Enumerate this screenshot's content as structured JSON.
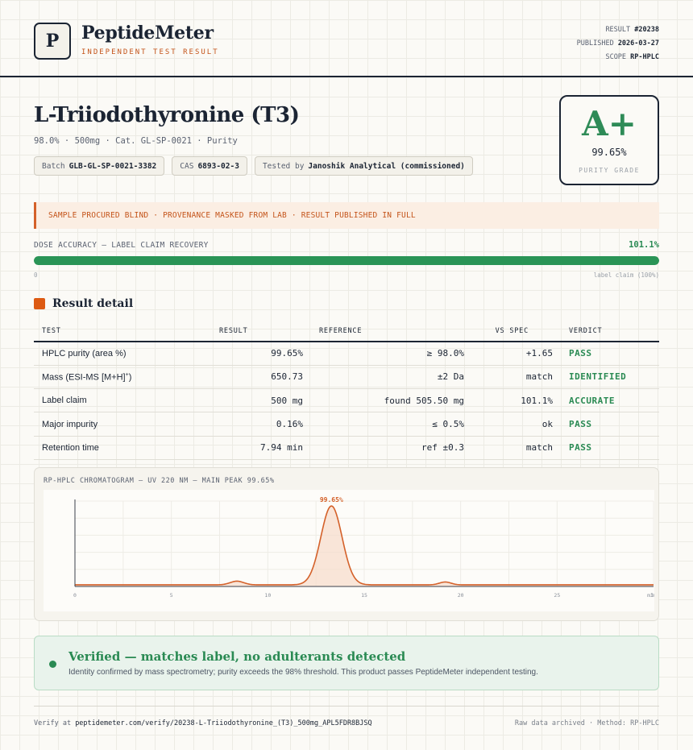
{
  "header": {
    "logo_letter": "P",
    "brand": "PeptideMeter",
    "tagline": "INDEPENDENT TEST RESULT",
    "result_label": "RESULT",
    "result_id": "#20238",
    "published_label": "PUBLISHED",
    "published_date": "2026-03-27",
    "scope_label": "SCOPE",
    "scope_value": "RP-HPLC"
  },
  "product": {
    "title": "L-Triiodothyronine (T3)",
    "subtitle": "98.0% · 500mg · Cat. GL-SP-0021 · Purity",
    "chips": {
      "batch_label": "Batch",
      "batch_value": "GLB-GL-SP-0021-3382",
      "cas_label": "CAS",
      "cas_value": "6893-02-3",
      "tested_label": "Tested by",
      "tested_value": "Janoshik Analytical (commissioned)"
    }
  },
  "grade": {
    "letter": "A+",
    "value": "99.65%",
    "label": "PURITY GRADE"
  },
  "notice": "SAMPLE PROCURED BLIND · PROVENANCE MASKED FROM LAB · RESULT PUBLISHED IN FULL",
  "dose": {
    "label": "DOSE ACCURACY — LABEL CLAIM RECOVERY",
    "value": "101.1%",
    "fill_fraction": 1.0,
    "min_label": "0",
    "max_label": "label claim (100%)"
  },
  "section_title": "Result detail",
  "table": {
    "headers": [
      "TEST",
      "RESULT",
      "REFERENCE",
      "VS SPEC",
      "VERDICT"
    ],
    "rows": [
      {
        "test": "HPLC purity (area %)",
        "test_sup": "",
        "result": "99.65%",
        "reference": "≥ 98.0%",
        "vs_spec": "+1.65",
        "verdict": "PASS"
      },
      {
        "test": "Mass (ESI-MS [M+H]",
        "test_sup": "+",
        "test_tail": ")",
        "result": "650.73",
        "reference": "±2 Da",
        "vs_spec": "match",
        "verdict": "IDENTIFIED"
      },
      {
        "test": "Label claim",
        "test_sup": "",
        "result": "500 mg",
        "reference": "found 505.50 mg",
        "vs_spec": "101.1%",
        "verdict": "ACCURATE"
      },
      {
        "test": "Major impurity",
        "test_sup": "",
        "result": "0.16%",
        "reference": "≤ 0.5%",
        "vs_spec": "ok",
        "verdict": "PASS"
      },
      {
        "test": "Retention time",
        "test_sup": "",
        "result": "7.94 min",
        "reference": "ref ±0.3",
        "vs_spec": "match",
        "verdict": "PASS"
      }
    ]
  },
  "chart_data": {
    "type": "line",
    "title": "RP-HPLC CHROMATOGRAM — UV 220 NM — MAIN PEAK 99.65%",
    "xlabel": "",
    "ylabel": "",
    "xlim": [
      0,
      30
    ],
    "ylim": [
      0,
      1.05
    ],
    "x_ticks": [
      "0",
      "5",
      "10",
      "15",
      "20",
      "25",
      "30"
    ],
    "x_unit": "min",
    "grid": true,
    "peak_annotation": "99.65%",
    "baseline": 0.02,
    "peaks": [
      {
        "center": 8.4,
        "height": 0.045,
        "width": 0.35
      },
      {
        "center": 13.3,
        "height": 0.97,
        "width": 0.55
      },
      {
        "center": 19.2,
        "height": 0.035,
        "width": 0.3
      }
    ],
    "line_color": "#d4612a",
    "fill_color": "#f6dccb"
  },
  "verified": {
    "title": "Verified — matches label, no adulterants detected",
    "text": "Identity confirmed by mass spectrometry; purity exceeds the 98% threshold. This product passes PeptideMeter independent testing."
  },
  "footer": {
    "verify_prefix": "Verify at",
    "verify_url": "peptidemeter.com/verify/20238-L-Triiodothyronine_(T3)_500mg_APL5FDR8BJSQ",
    "right_text": "Raw data archived · Method: RP-HPLC"
  },
  "colors": {
    "accent": "#d4612a",
    "pass": "#2a8a53",
    "ink": "#1b2433"
  }
}
